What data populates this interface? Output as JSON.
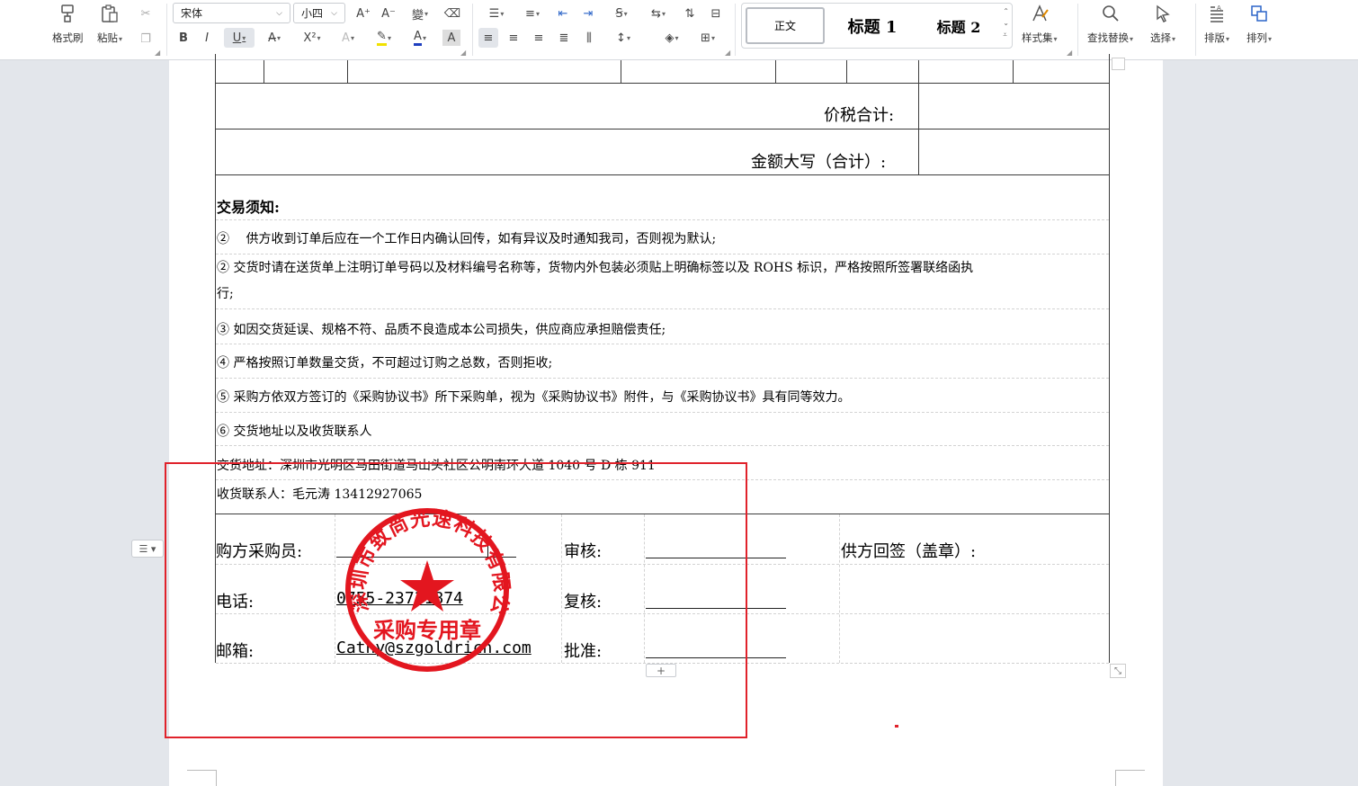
{
  "ribbon": {
    "format_painter": "格式刷",
    "paste": "粘贴",
    "font_name": "宋体",
    "font_size": "小四",
    "style_normal": "正文",
    "style_h1": "标题 1",
    "style_h2": "标题 2",
    "style_set": "样式集",
    "find_replace": "查找替换",
    "select": "选择",
    "layout": "排版",
    "arrange": "排列"
  },
  "doc": {
    "total_tax_label": "价税合计:",
    "amount_words_label": "金额大写（合计）:",
    "notice_title": "交易须知:",
    "notice_1": "②　 供方收到订单后应在一个工作日内确认回传，如有异议及时通知我司，否则视为默认;",
    "notice_2a": "② 交货时请在送货单上注明订单号码以及材料编号名称等，货物内外包装必须贴上明确标签以及 ROHS 标识，严格按照所签署联络函执",
    "notice_2b": "行;",
    "notice_3": "③ 如因交货延误、规格不符、品质不良造成本公司损失，供应商应承担赔偿责任;",
    "notice_4": "④ 严格按照订单数量交货，不可超过订购之总数，否则拒收;",
    "notice_5": "⑤ 采购方依双方签订的《采购协议书》所下采购单，视为《采购协议书》附件，与《采购协议书》具有同等效力。",
    "notice_6": "⑥ 交货地址以及收货联系人",
    "address": "交货地址：深圳市光明区马田街道马山头社区公明南环大道 1040 号 D 栋 911",
    "contact": "收货联系人：毛元涛 13412927065",
    "buyer_label": "购方采购员:",
    "phone_label": "电话:",
    "phone_value": "0755-23731874",
    "email_label": "邮箱:",
    "email_value": "Cathy@szgoldrich.com",
    "review_label": "审核:",
    "recheck_label": "复核:",
    "approve_label": "批准:",
    "supplier_sign": "供方回签（盖章）:"
  },
  "stamp": {
    "company": "深圳市致尚光速科技有限公司",
    "purpose": "采购专用章",
    "color": "#e3161f"
  },
  "colors": {
    "selection": "#e0222b",
    "accent_blue": "#2b64c8"
  }
}
